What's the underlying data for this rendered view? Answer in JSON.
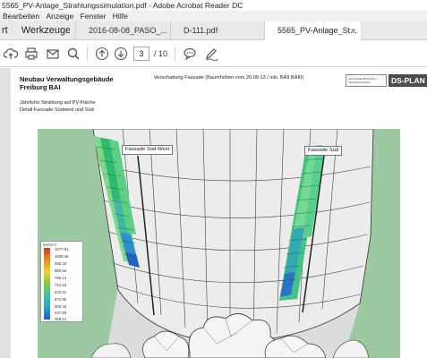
{
  "window": {
    "title": "5565_PV-Anlage_Strahlungssimulation.pdf - Adobe Acrobat Reader DC"
  },
  "menu": [
    "Bearbeiten",
    "Anzeige",
    "Fenster",
    "Hilfe"
  ],
  "tabs": {
    "home_fragment": "rt",
    "tools": "Werkzeuge",
    "documents": [
      {
        "label": "2016-08-08_PASO_..."
      },
      {
        "label": "D-111.pdf"
      },
      {
        "label": "5565_PV-Anlage_St..."
      }
    ],
    "close_glyph": "×"
  },
  "toolbar": {
    "icons": [
      "upload-icon",
      "print-icon",
      "mail-icon",
      "search-icon",
      "prev-page-icon",
      "next-page-icon",
      "comment-icon",
      "pen-icon"
    ],
    "page_current": "3",
    "page_total": "/ 10"
  },
  "document": {
    "title_line1": "Neubau Verwaltungsgebäude",
    "title_line2": "Freiburg BAI",
    "subtitle_line1": "Jährliche Strahlung auf PV-Fläche",
    "subtitle_line2": "Detail Fassade Südwest und Süd",
    "center_header": "Verschattung Fassade (Baumhöhen vom 20.09.13 / inkl. BAII BAIII)",
    "logo_small": "ADVANCED BUILDING TECHNOLOGIES",
    "logo_brand": "DS-PLAN",
    "label_southwest": "Fassade Süd-West",
    "label_south": "Fassade Süd",
    "legend": {
      "unit": "kWh/m²",
      "values": [
        "1077.81",
        "1008.46",
        "935.18",
        "880.56",
        "786.14",
        "714.53",
        "644.31",
        "572.99",
        "500.40",
        "437.83",
        "365.14"
      ]
    }
  },
  "colors": {
    "accent": "#1a73d9",
    "panel_ground": "#9cc9a2",
    "brand_dark": "#4c4c4c"
  }
}
